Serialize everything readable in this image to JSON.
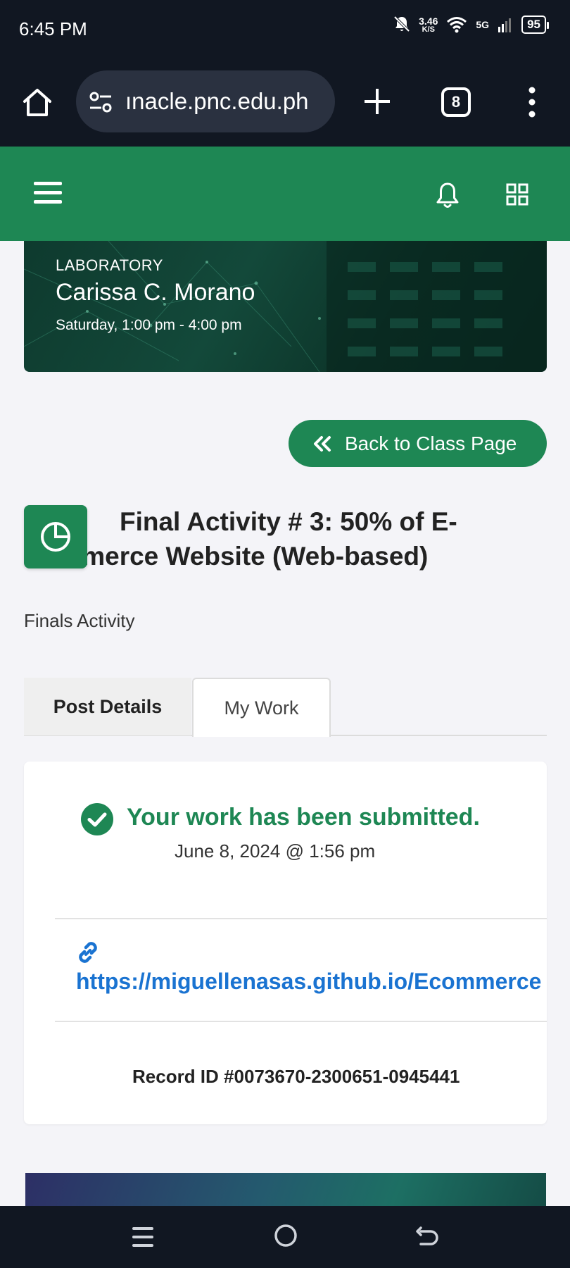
{
  "status_bar": {
    "time": "6:45 PM",
    "net_speed_value": "3.46",
    "net_speed_unit": "K/S",
    "network": "5G",
    "battery": "95"
  },
  "browser": {
    "url": "ınacle.pnc.edu.ph",
    "tab_count": "8"
  },
  "class_banner": {
    "kind": "LABORATORY",
    "teacher": "Carissa C. Morano",
    "schedule": "Saturday, 1:00 pm - 4:00 pm"
  },
  "back_button": {
    "label": "Back to Class Page"
  },
  "activity": {
    "title": "Final Activity # 3: 50% of E-Commerce Website (Web-based)",
    "category": "Finals Activity"
  },
  "tabs": [
    {
      "label": "Post Details",
      "active": false
    },
    {
      "label": "My Work",
      "active": true
    }
  ],
  "submission": {
    "status": "Your work has been submitted.",
    "date": "June 8, 2024 @ 1:56 pm",
    "link": "https://miguellenasas.github.io/Ecommerce",
    "record_id": "Record ID #0073670-2300651-0945441"
  },
  "colors": {
    "brand_green": "#1e8754",
    "link_blue": "#1a73d1",
    "system_bar": "#111722"
  },
  "icons": [
    "home-icon",
    "tune-icon",
    "plus-icon",
    "more-vert-icon",
    "hamburger-icon",
    "bell-icon",
    "grid-icon",
    "double-chevron-left-icon",
    "pie-chart-icon",
    "check-circle-icon",
    "link-icon",
    "recents-icon",
    "nav-home-icon",
    "nav-back-icon"
  ]
}
